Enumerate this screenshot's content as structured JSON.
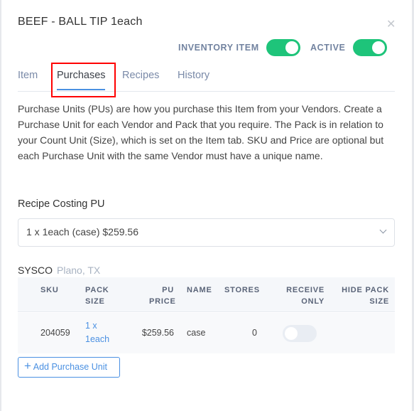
{
  "modal": {
    "title": "BEEF - BALL TIP 1each",
    "close_icon": "close-icon",
    "toggles": [
      {
        "label": "INVENTORY ITEM",
        "on": true
      },
      {
        "label": "ACTIVE",
        "on": true
      }
    ],
    "accent_color": "#1ec47a"
  },
  "tabs": [
    {
      "label": "Item"
    },
    {
      "label": "Purchases",
      "active": true
    },
    {
      "label": "Recipes"
    },
    {
      "label": "History"
    }
  ],
  "description": "Purchase Units (PUs) are how you purchase this Item from your Vendors. Create a Purchase Unit for each Vendor and Pack that you require. The Pack is in relation to your Count Unit (Size), which is set on the Item tab. SKU and Price are optional but each Purchase Unit with the same Vendor must have a unique name.",
  "recipe_costing": {
    "label": "Recipe Costing PU",
    "selected": "1 x 1each (case) $259.56"
  },
  "vendor": {
    "name": "SYSCO",
    "location": "Plano, TX",
    "columns": [
      "SKU",
      "PACK SIZE",
      "PU PRICE",
      "NAME",
      "STORES",
      "RECEIVE ONLY",
      "HIDE PACK SIZE"
    ],
    "rows": [
      {
        "sku": "204059",
        "pack_line1": "1 x",
        "pack_line2": "1each",
        "price": "$259.56",
        "name": "case",
        "stores": "0",
        "receive_only": false
      }
    ]
  },
  "add_button": "Add Purchase Unit"
}
